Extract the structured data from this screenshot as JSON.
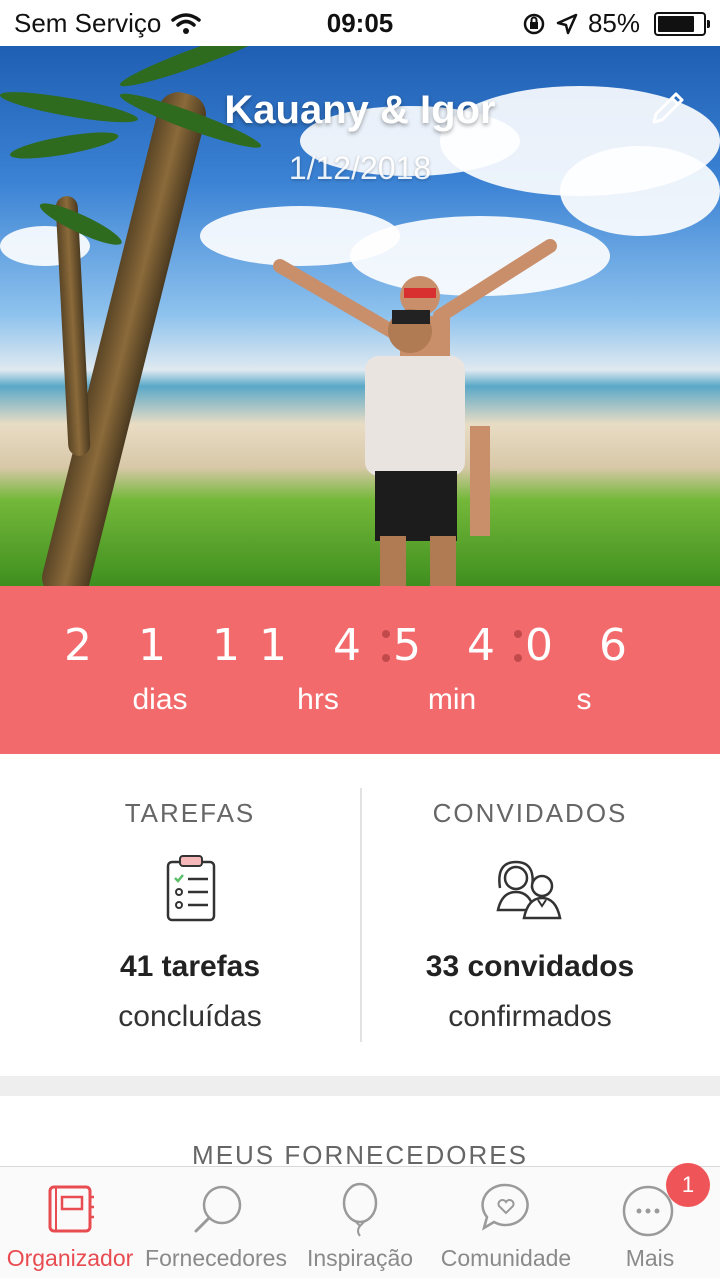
{
  "status_bar": {
    "carrier": "Sem Serviço",
    "time": "09:05",
    "battery": "85%"
  },
  "hero": {
    "couple_names": "Kauany & Igor",
    "wedding_date": "1/12/2018"
  },
  "countdown": {
    "days": "2 1 1",
    "days_label": "dias",
    "hours": "1 4",
    "hours_label": "hrs",
    "minutes": "5 4",
    "minutes_label": "min",
    "seconds": "0 6",
    "seconds_label": "s"
  },
  "stats": {
    "tasks": {
      "title": "TAREFAS",
      "value": "41 tarefas",
      "sub": "concluídas"
    },
    "guests": {
      "title": "CONVIDADOS",
      "value": "33 convidados",
      "sub": "confirmados"
    }
  },
  "section": {
    "title": "MEUS FORNECEDORES"
  },
  "tabbar": {
    "tabs": [
      {
        "label": "Organizador",
        "icon": "planner-icon",
        "active": true
      },
      {
        "label": "Fornecedores",
        "icon": "search-icon",
        "active": false
      },
      {
        "label": "Inspiração",
        "icon": "balloon-icon",
        "active": false
      },
      {
        "label": "Comunidade",
        "icon": "chat-heart-icon",
        "active": false
      },
      {
        "label": "Mais",
        "icon": "more-icon",
        "active": false,
        "badge": "1"
      }
    ]
  },
  "colors": {
    "accent": "#f26a6c",
    "active_tab": "#e84b50",
    "badge": "#ef5558"
  }
}
